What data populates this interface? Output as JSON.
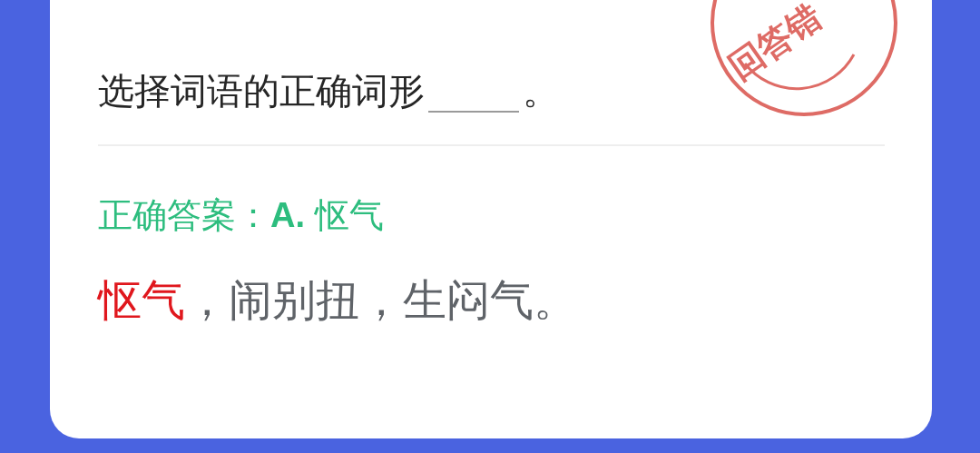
{
  "question": {
    "text": "选择词语的正确词形",
    "end": "。"
  },
  "stamp": {
    "text": "回答错"
  },
  "answer": {
    "label": "正确答案：",
    "letter": "A.",
    "word": "怄气"
  },
  "explanation": {
    "highlight": "怄气",
    "rest": "，闹别扭，生闷气。"
  }
}
